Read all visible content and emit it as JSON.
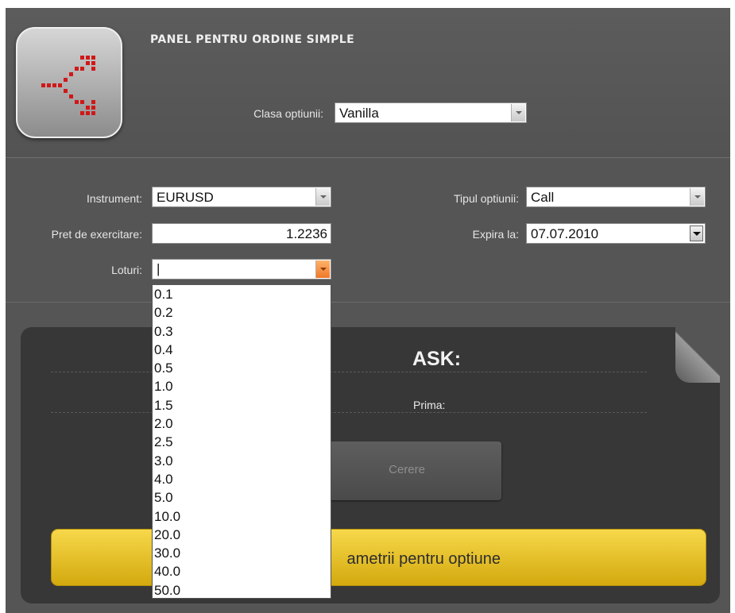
{
  "header": {
    "title": "PANEL PENTRU ORDINE SIMPLE",
    "option_class_label": "Clasa optiunii:",
    "option_class_value": "Vanilla"
  },
  "form": {
    "instrument_label": "Instrument:",
    "instrument_value": "EURUSD",
    "strike_label": "Pret de exercitare:",
    "strike_value": "1.2236",
    "lots_label": "Loturi:",
    "lots_value": "",
    "option_type_label": "Tipul optiunii:",
    "option_type_value": "Call",
    "expiry_label": "Expira la:",
    "expiry_value": "07.07.2010"
  },
  "lots_options": [
    "0.1",
    "0.2",
    "0.3",
    "0.4",
    "0.5",
    "1.0",
    "1.5",
    "2.0",
    "2.5",
    "3.0",
    "4.0",
    "5.0",
    "10.0",
    "20.0",
    "30.0",
    "40.0",
    "50.0"
  ],
  "quote": {
    "ask_label": "ASK:",
    "premium_label": "Prima:"
  },
  "buttons": {
    "request_label": "Cerere",
    "params_label": "ametrii pentru optiune"
  },
  "icons": {
    "logo": "red-split-arrows-icon",
    "dropdown": "chevron-down-icon"
  },
  "colors": {
    "background": "#555555",
    "panel": "#373737",
    "accent_yellow": "#e8c22a",
    "logo_red": "#d01818",
    "dropdown_active": "#f0782a"
  }
}
